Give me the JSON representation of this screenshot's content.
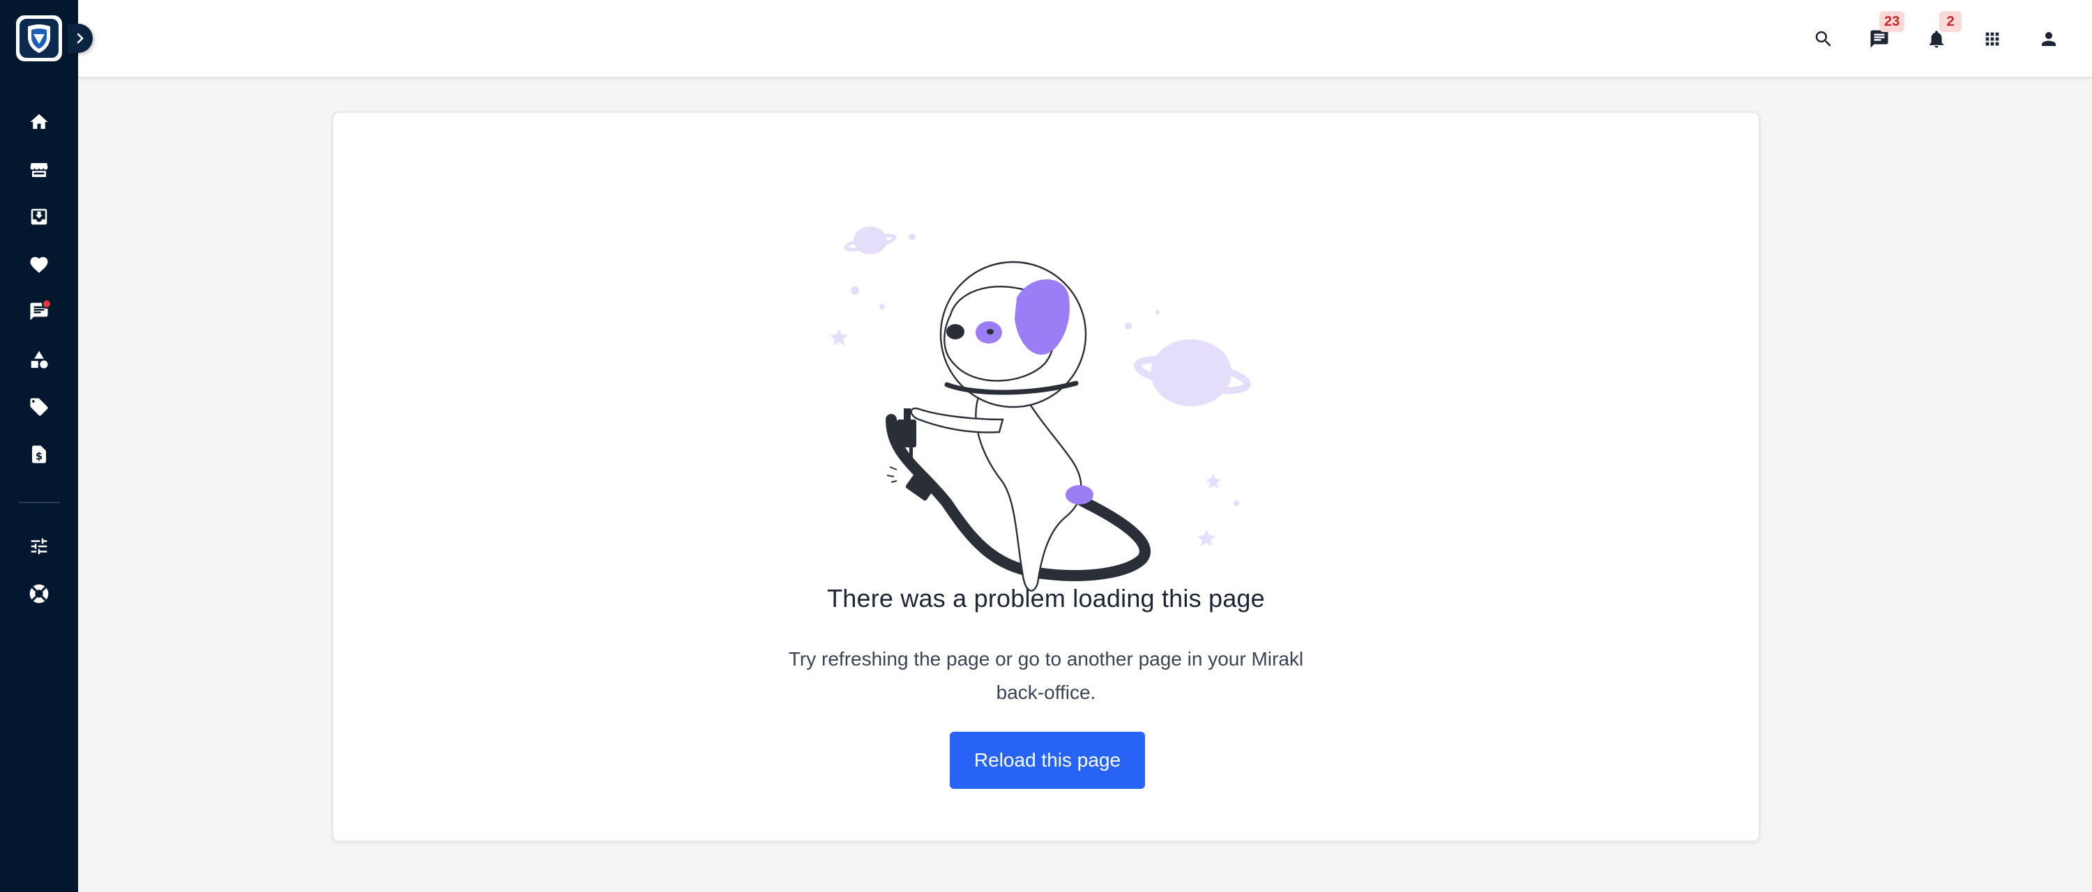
{
  "sidebar": {
    "logo_icon": "shield-logo-icon",
    "expand_icon": "chevron-right-icon",
    "items": [
      {
        "icon": "home-icon"
      },
      {
        "icon": "store-icon"
      },
      {
        "icon": "inbox-download-icon"
      },
      {
        "icon": "heart-icon"
      },
      {
        "icon": "message-icon",
        "has_notification_dot": true
      },
      {
        "icon": "shapes-icon"
      },
      {
        "icon": "tag-icon"
      },
      {
        "icon": "invoice-dollar-icon"
      }
    ],
    "bottom_items": [
      {
        "icon": "settings-sliders-icon"
      },
      {
        "icon": "help-lifebuoy-icon"
      }
    ]
  },
  "topbar": {
    "search_icon": "search-icon",
    "messages": {
      "icon": "message-icon",
      "count": "23"
    },
    "notifications": {
      "icon": "bell-icon",
      "count": "2"
    },
    "apps_icon": "apps-grid-icon",
    "user_icon": "user-icon"
  },
  "error": {
    "title": "There was a problem loading this page",
    "message": "Try refreshing the page or go to another page in your Mirakl back-office.",
    "button_label": "Reload this page"
  },
  "colors": {
    "sidebar_bg": "#03182f",
    "primary_button": "#2764f5",
    "accent_purple": "#9b7ef5",
    "badge_bg": "#fcd9d9",
    "badge_text": "#c62828"
  }
}
